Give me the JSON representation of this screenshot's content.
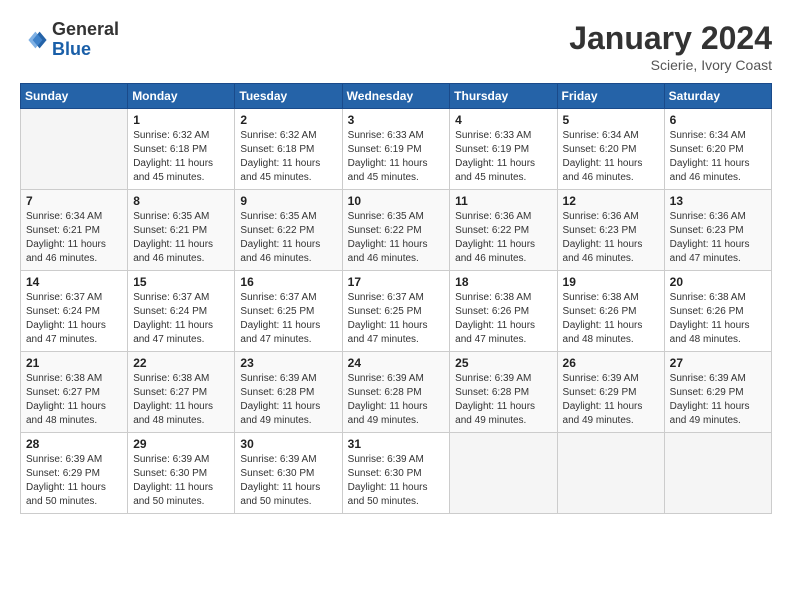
{
  "header": {
    "logo_general": "General",
    "logo_blue": "Blue",
    "month_title": "January 2024",
    "location": "Scierie, Ivory Coast"
  },
  "days_of_week": [
    "Sunday",
    "Monday",
    "Tuesday",
    "Wednesday",
    "Thursday",
    "Friday",
    "Saturday"
  ],
  "weeks": [
    [
      {
        "day": "",
        "info": ""
      },
      {
        "day": "1",
        "info": "Sunrise: 6:32 AM\nSunset: 6:18 PM\nDaylight: 11 hours and 45 minutes."
      },
      {
        "day": "2",
        "info": "Sunrise: 6:32 AM\nSunset: 6:18 PM\nDaylight: 11 hours and 45 minutes."
      },
      {
        "day": "3",
        "info": "Sunrise: 6:33 AM\nSunset: 6:19 PM\nDaylight: 11 hours and 45 minutes."
      },
      {
        "day": "4",
        "info": "Sunrise: 6:33 AM\nSunset: 6:19 PM\nDaylight: 11 hours and 45 minutes."
      },
      {
        "day": "5",
        "info": "Sunrise: 6:34 AM\nSunset: 6:20 PM\nDaylight: 11 hours and 46 minutes."
      },
      {
        "day": "6",
        "info": "Sunrise: 6:34 AM\nSunset: 6:20 PM\nDaylight: 11 hours and 46 minutes."
      }
    ],
    [
      {
        "day": "7",
        "info": "Sunrise: 6:34 AM\nSunset: 6:21 PM\nDaylight: 11 hours and 46 minutes."
      },
      {
        "day": "8",
        "info": "Sunrise: 6:35 AM\nSunset: 6:21 PM\nDaylight: 11 hours and 46 minutes."
      },
      {
        "day": "9",
        "info": "Sunrise: 6:35 AM\nSunset: 6:22 PM\nDaylight: 11 hours and 46 minutes."
      },
      {
        "day": "10",
        "info": "Sunrise: 6:35 AM\nSunset: 6:22 PM\nDaylight: 11 hours and 46 minutes."
      },
      {
        "day": "11",
        "info": "Sunrise: 6:36 AM\nSunset: 6:22 PM\nDaylight: 11 hours and 46 minutes."
      },
      {
        "day": "12",
        "info": "Sunrise: 6:36 AM\nSunset: 6:23 PM\nDaylight: 11 hours and 46 minutes."
      },
      {
        "day": "13",
        "info": "Sunrise: 6:36 AM\nSunset: 6:23 PM\nDaylight: 11 hours and 47 minutes."
      }
    ],
    [
      {
        "day": "14",
        "info": "Sunrise: 6:37 AM\nSunset: 6:24 PM\nDaylight: 11 hours and 47 minutes."
      },
      {
        "day": "15",
        "info": "Sunrise: 6:37 AM\nSunset: 6:24 PM\nDaylight: 11 hours and 47 minutes."
      },
      {
        "day": "16",
        "info": "Sunrise: 6:37 AM\nSunset: 6:25 PM\nDaylight: 11 hours and 47 minutes."
      },
      {
        "day": "17",
        "info": "Sunrise: 6:37 AM\nSunset: 6:25 PM\nDaylight: 11 hours and 47 minutes."
      },
      {
        "day": "18",
        "info": "Sunrise: 6:38 AM\nSunset: 6:26 PM\nDaylight: 11 hours and 47 minutes."
      },
      {
        "day": "19",
        "info": "Sunrise: 6:38 AM\nSunset: 6:26 PM\nDaylight: 11 hours and 48 minutes."
      },
      {
        "day": "20",
        "info": "Sunrise: 6:38 AM\nSunset: 6:26 PM\nDaylight: 11 hours and 48 minutes."
      }
    ],
    [
      {
        "day": "21",
        "info": "Sunrise: 6:38 AM\nSunset: 6:27 PM\nDaylight: 11 hours and 48 minutes."
      },
      {
        "day": "22",
        "info": "Sunrise: 6:38 AM\nSunset: 6:27 PM\nDaylight: 11 hours and 48 minutes."
      },
      {
        "day": "23",
        "info": "Sunrise: 6:39 AM\nSunset: 6:28 PM\nDaylight: 11 hours and 49 minutes."
      },
      {
        "day": "24",
        "info": "Sunrise: 6:39 AM\nSunset: 6:28 PM\nDaylight: 11 hours and 49 minutes."
      },
      {
        "day": "25",
        "info": "Sunrise: 6:39 AM\nSunset: 6:28 PM\nDaylight: 11 hours and 49 minutes."
      },
      {
        "day": "26",
        "info": "Sunrise: 6:39 AM\nSunset: 6:29 PM\nDaylight: 11 hours and 49 minutes."
      },
      {
        "day": "27",
        "info": "Sunrise: 6:39 AM\nSunset: 6:29 PM\nDaylight: 11 hours and 49 minutes."
      }
    ],
    [
      {
        "day": "28",
        "info": "Sunrise: 6:39 AM\nSunset: 6:29 PM\nDaylight: 11 hours and 50 minutes."
      },
      {
        "day": "29",
        "info": "Sunrise: 6:39 AM\nSunset: 6:30 PM\nDaylight: 11 hours and 50 minutes."
      },
      {
        "day": "30",
        "info": "Sunrise: 6:39 AM\nSunset: 6:30 PM\nDaylight: 11 hours and 50 minutes."
      },
      {
        "day": "31",
        "info": "Sunrise: 6:39 AM\nSunset: 6:30 PM\nDaylight: 11 hours and 50 minutes."
      },
      {
        "day": "",
        "info": ""
      },
      {
        "day": "",
        "info": ""
      },
      {
        "day": "",
        "info": ""
      }
    ]
  ]
}
